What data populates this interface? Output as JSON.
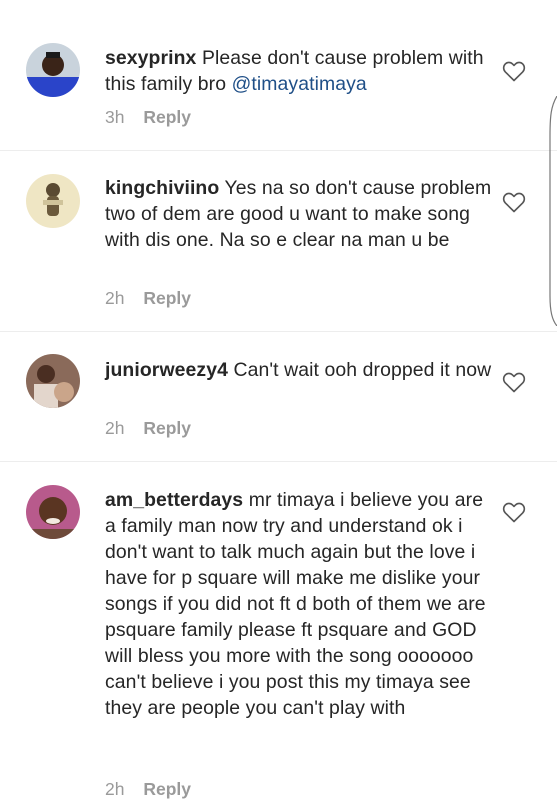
{
  "comments": [
    {
      "username": "sexyprinx",
      "text": "Please don't cause problem with this family bro ",
      "mention": "@timayatimaya",
      "time": "3h",
      "reply_label": "Reply",
      "avatar_icon": "avatar-photo",
      "like_icon": "heart-icon"
    },
    {
      "username": "kingchiviino",
      "text": "Yes na so don't cause problem two of dem are good u want to make song with dis one. Na so e clear na man u be",
      "time": "2h",
      "reply_label": "Reply",
      "avatar_icon": "avatar-photo",
      "like_icon": "heart-icon"
    },
    {
      "username": "juniorweezy4",
      "text": "Can't wait ooh dropped it now",
      "time": "2h",
      "reply_label": "Reply",
      "avatar_icon": "avatar-photo",
      "like_icon": "heart-icon"
    },
    {
      "username": "am_betterdays",
      "text": "mr timaya i believe you are a family man now try and understand ok i don't want to talk much again but the love i have for p square will make me dislike your songs if you did not ft d both of them we are psquare family please ft psquare and GOD will bless you more with the song ooooooo can't believe i you post this my timaya see they are people you can't play with",
      "time": "2h",
      "reply_label": "Reply",
      "avatar_icon": "avatar-photo",
      "like_icon": "heart-icon"
    }
  ],
  "colors": {
    "text": "#262626",
    "mention": "#1f4f87",
    "meta": "#9a9a9a",
    "divider": "#ededed"
  }
}
